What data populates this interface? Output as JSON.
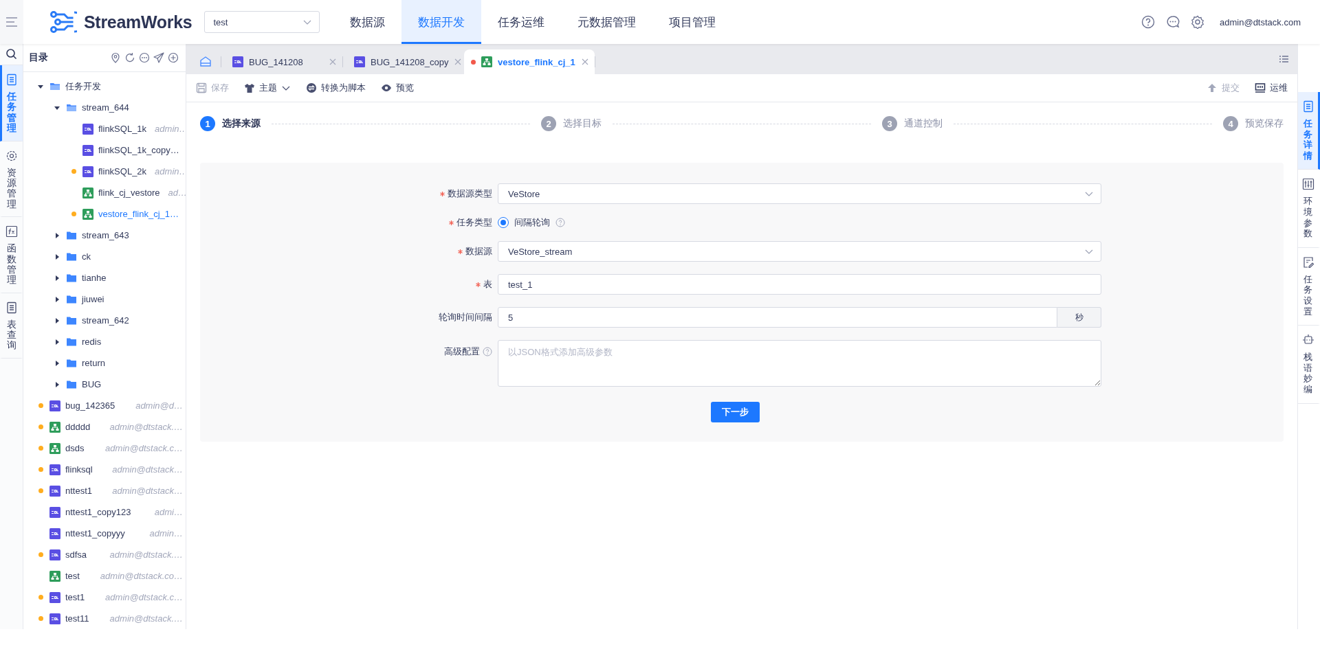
{
  "header": {
    "brand": "StreamWorks",
    "project_select": {
      "value": "test"
    },
    "nav": [
      {
        "label": "数据源",
        "selected": false
      },
      {
        "label": "数据开发",
        "selected": true
      },
      {
        "label": "任务运维",
        "selected": false
      },
      {
        "label": "元数据管理",
        "selected": false
      },
      {
        "label": "项目管理",
        "selected": false
      }
    ],
    "user": "admin@dtstack.com"
  },
  "left_rail": [
    {
      "label": "任务管理",
      "selected": true
    },
    {
      "label": "资源管理",
      "selected": false
    },
    {
      "label": "函数管理",
      "selected": false
    },
    {
      "label": "表查询",
      "selected": false
    }
  ],
  "tree": {
    "title": "目录",
    "items": [
      {
        "name": "任务开发",
        "kind": "folder",
        "expanded": true,
        "selected": false,
        "children": [
          {
            "name": "stream_644",
            "kind": "folder",
            "expanded": true,
            "selected": false,
            "children": [
              {
                "name": "flinkSQL_1k",
                "kind": "sql",
                "modified": false,
                "selected": false,
                "owner": "admin…"
              },
              {
                "name": "flinkSQL_1k_copy…",
                "kind": "sql",
                "modified": false,
                "selected": false
              },
              {
                "name": "flinkSQL_2k",
                "kind": "sql",
                "modified": true,
                "selected": false,
                "owner": "admin…"
              },
              {
                "name": "flink_cj_vestore",
                "kind": "flow",
                "modified": false,
                "selected": false,
                "owner": "ad…"
              },
              {
                "name": "vestore_flink_cj_1…",
                "kind": "flow",
                "modified": true,
                "selected": true
              }
            ]
          },
          {
            "name": "stream_643",
            "kind": "folder",
            "expanded": false,
            "selected": false
          },
          {
            "name": "ck",
            "kind": "folder",
            "expanded": false,
            "selected": false
          },
          {
            "name": "tianhe",
            "kind": "folder",
            "expanded": false,
            "selected": false
          },
          {
            "name": "jiuwei",
            "kind": "folder",
            "expanded": false,
            "selected": false
          },
          {
            "name": "stream_642",
            "kind": "folder",
            "expanded": false,
            "selected": false
          },
          {
            "name": "redis",
            "kind": "folder",
            "expanded": false,
            "selected": false
          },
          {
            "name": "return",
            "kind": "folder",
            "expanded": false,
            "selected": false
          },
          {
            "name": "BUG",
            "kind": "folder",
            "expanded": false,
            "selected": false
          }
        ]
      },
      {
        "name": "bug_142365",
        "kind": "sql",
        "modified": true,
        "selected": false,
        "owner": "admin@d…"
      },
      {
        "name": "ddddd",
        "kind": "flow",
        "modified": true,
        "selected": false,
        "owner": "admin@dtstack.…"
      },
      {
        "name": "dsds",
        "kind": "flow",
        "modified": true,
        "selected": false,
        "owner": "admin@dtstack.c…"
      },
      {
        "name": "flinksql",
        "kind": "sql",
        "modified": true,
        "selected": false,
        "owner": "admin@dtstack…"
      },
      {
        "name": "nttest1",
        "kind": "sql",
        "modified": true,
        "selected": false,
        "owner": "admin@dtstack…"
      },
      {
        "name": "nttest1_copy123",
        "kind": "sql",
        "modified": false,
        "selected": false,
        "owner": "admi…"
      },
      {
        "name": "nttest1_copyyy",
        "kind": "sql",
        "modified": false,
        "selected": false,
        "owner": "admin…"
      },
      {
        "name": "sdfsa",
        "kind": "sql",
        "modified": true,
        "selected": false,
        "owner": "admin@dtstack.…"
      },
      {
        "name": "test",
        "kind": "flow",
        "modified": false,
        "selected": false,
        "owner": "admin@dtstack.co…"
      },
      {
        "name": "test1",
        "kind": "sql",
        "modified": true,
        "selected": false,
        "owner": "admin@dtstack.c…"
      },
      {
        "name": "test11",
        "kind": "sql",
        "modified": true,
        "selected": false,
        "owner": "admin@dtstack.…"
      }
    ]
  },
  "tabs": [
    {
      "label": "BUG_141208",
      "kind": "sql",
      "modified": false,
      "selected": false
    },
    {
      "label": "BUG_141208_copy",
      "kind": "sql",
      "modified": false,
      "selected": false
    },
    {
      "label": "vestore_flink_cj_1",
      "kind": "flow",
      "modified": true,
      "selected": true
    }
  ],
  "toolbar": {
    "left": [
      {
        "label": "保存",
        "disabled": true,
        "dropdown": false
      },
      {
        "label": "主题",
        "disabled": false,
        "dropdown": true
      },
      {
        "label": "转换为脚本",
        "disabled": false,
        "dropdown": false
      },
      {
        "label": "预览",
        "disabled": false,
        "dropdown": false
      }
    ],
    "right": [
      {
        "label": "提交",
        "disabled": true,
        "dropdown": false
      },
      {
        "label": "运维",
        "disabled": false,
        "dropdown": false
      }
    ]
  },
  "steps": [
    {
      "number": "1",
      "label": "选择来源",
      "active": true
    },
    {
      "number": "2",
      "label": "选择目标",
      "active": false
    },
    {
      "number": "3",
      "label": "通道控制",
      "active": false
    },
    {
      "number": "4",
      "label": "预览保存",
      "active": false
    }
  ],
  "form": {
    "fields": [
      {
        "label": "数据源类型",
        "kind": "select",
        "required": true,
        "value": "VeStore"
      },
      {
        "label": "任务类型",
        "kind": "radio",
        "required": true,
        "option": "间隔轮询",
        "checked": true
      },
      {
        "label": "数据源",
        "kind": "select",
        "required": true,
        "value": "VeStore_stream"
      },
      {
        "label": "表",
        "kind": "input",
        "required": true,
        "value": "test_1"
      },
      {
        "label": "轮询时间间隔",
        "kind": "addon",
        "required": false,
        "value": "5",
        "addon": "秒"
      },
      {
        "label": "高级配置",
        "kind": "textarea",
        "required": false,
        "help": true,
        "placeholder": "以JSON格式添加高级参数"
      }
    ],
    "submit": "下一步"
  },
  "right_rail": [
    {
      "label": "任务详情",
      "selected": true
    },
    {
      "label": "环境参数",
      "selected": false
    },
    {
      "label": "任务设置",
      "selected": false
    },
    {
      "label": "栈语妙编",
      "selected": false
    }
  ]
}
